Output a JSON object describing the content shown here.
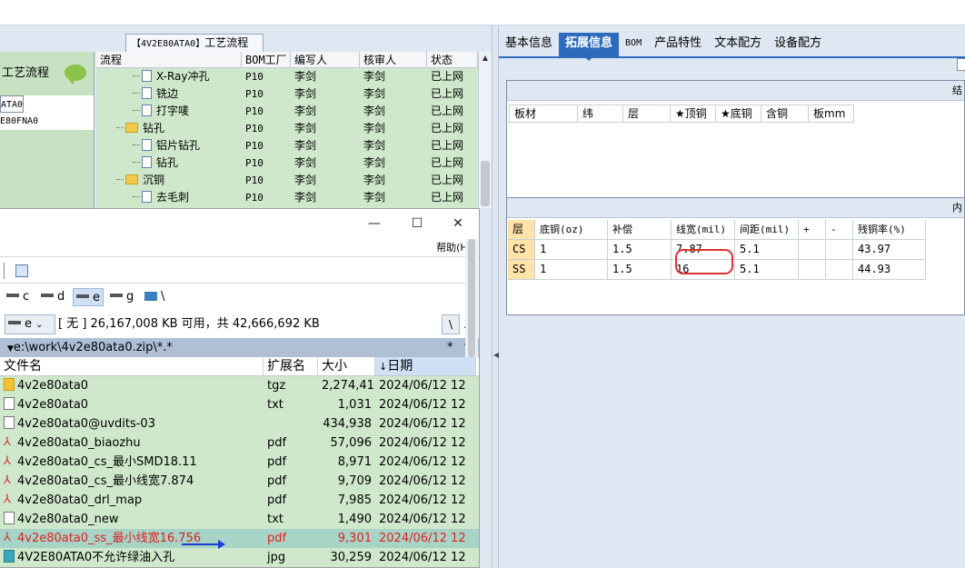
{
  "flow_tab": {
    "prefix": "【4V2E80ATA0】",
    "suffix": "工艺流程"
  },
  "left_tree": {
    "header": "工艺流程",
    "nodes": [
      "ATA0",
      "E80FNA0"
    ]
  },
  "flow_table": {
    "headers": [
      "流程",
      "BOM工厂",
      "编写人",
      "核审人",
      "状态"
    ],
    "rows": [
      {
        "kind": "doc",
        "name": "X-Ray冲孔",
        "bom": "P10",
        "writer": "李剑",
        "reviewer": "李剑",
        "status": "已上网"
      },
      {
        "kind": "doc",
        "name": "铣边",
        "bom": "P10",
        "writer": "李剑",
        "reviewer": "李剑",
        "status": "已上网"
      },
      {
        "kind": "doc",
        "name": "打字唛",
        "bom": "P10",
        "writer": "李剑",
        "reviewer": "李剑",
        "status": "已上网"
      },
      {
        "kind": "folder",
        "name": "钻孔",
        "bom": "P10",
        "writer": "李剑",
        "reviewer": "李剑",
        "status": "已上网"
      },
      {
        "kind": "doc",
        "name": "铝片钻孔",
        "bom": "P10",
        "writer": "李剑",
        "reviewer": "李剑",
        "status": "已上网"
      },
      {
        "kind": "doc",
        "name": "钻孔",
        "bom": "P10",
        "writer": "李剑",
        "reviewer": "李剑",
        "status": "已上网"
      },
      {
        "kind": "folder",
        "name": "沉铜",
        "bom": "P10",
        "writer": "李剑",
        "reviewer": "李剑",
        "status": "已上网"
      },
      {
        "kind": "doc",
        "name": "去毛刺",
        "bom": "P10",
        "writer": "李剑",
        "reviewer": "李剑",
        "status": "已上网"
      }
    ]
  },
  "file_manager": {
    "window_buttons": [
      "—",
      "☐",
      "✕"
    ],
    "menu_help": "帮助(H)",
    "drives": [
      "c",
      "d",
      "e",
      "g",
      "\\"
    ],
    "active_drive": "e",
    "selected_drive": "e",
    "drive_info": "[ 无 ]  26,167,008 KB 可用，共 42,666,692 KB",
    "root_button": "\\",
    "up_button": "..",
    "current_path": "e:\\work\\4v2e80ata0.zip\\*.*",
    "filter": "*",
    "columns": [
      "文件名",
      "扩展名",
      "大小",
      "日期"
    ],
    "files": [
      {
        "icon": "zip",
        "name": "4v2e80ata0",
        "ext": "tgz",
        "size": "2,274,415",
        "date": "2024/06/12 12"
      },
      {
        "icon": "txt",
        "name": "4v2e80ata0",
        "ext": "txt",
        "size": "1,031",
        "date": "2024/06/12 12"
      },
      {
        "icon": "txt",
        "name": "4v2e80ata0@uvdits-03",
        "ext": "",
        "size": "434,938",
        "date": "2024/06/12 12"
      },
      {
        "icon": "pdf",
        "name": "4v2e80ata0_biaozhu",
        "ext": "pdf",
        "size": "57,096",
        "date": "2024/06/12 12"
      },
      {
        "icon": "pdf",
        "name": "4v2e80ata0_cs_最小SMD18.11",
        "ext": "pdf",
        "size": "8,971",
        "date": "2024/06/12 12"
      },
      {
        "icon": "pdf",
        "name": "4v2e80ata0_cs_最小线宽7.874",
        "ext": "pdf",
        "size": "9,709",
        "date": "2024/06/12 12"
      },
      {
        "icon": "pdf",
        "name": "4v2e80ata0_drl_map",
        "ext": "pdf",
        "size": "7,985",
        "date": "2024/06/12 12"
      },
      {
        "icon": "txt",
        "name": "4v2e80ata0_new",
        "ext": "txt",
        "size": "1,490",
        "date": "2024/06/12 12"
      },
      {
        "icon": "pdf",
        "name": "4v2e80ata0_ss_最小线宽16.756",
        "ext": "pdf",
        "size": "9,301",
        "date": "2024/06/12 12",
        "highlight": true
      },
      {
        "icon": "jpg",
        "name": "4V2E80ATA0不允许绿油入孔",
        "ext": "jpg",
        "size": "30,259",
        "date": "2024/06/12 12"
      }
    ]
  },
  "right_panel": {
    "tabs": [
      "基本信息",
      "拓展信息",
      "BOM",
      "产品特性",
      "文本配方",
      "设备配方"
    ],
    "active_tab": "拓展信息",
    "panel1": {
      "title_fragment": "结",
      "columns": [
        "板材",
        "纬",
        "层",
        "★顶铜",
        "★底铜",
        "含铜",
        "板mm"
      ]
    },
    "panel2": {
      "title_fragment": "内",
      "headers": [
        "层",
        "底铜(oz)",
        "补偿",
        "线宽(mil)",
        "间距(mil)",
        "+",
        "-",
        "残铜率(%)"
      ],
      "rows": [
        {
          "layer": "CS",
          "base": "1",
          "comp": "1.5",
          "lw": "7.87",
          "sp": "5.1",
          "plus": "",
          "minus": "",
          "rr": "43.97"
        },
        {
          "layer": "SS",
          "base": "1",
          "comp": "1.5",
          "lw": "16",
          "sp": "5.1",
          "plus": "",
          "minus": "",
          "rr": "44.93"
        }
      ]
    }
  }
}
